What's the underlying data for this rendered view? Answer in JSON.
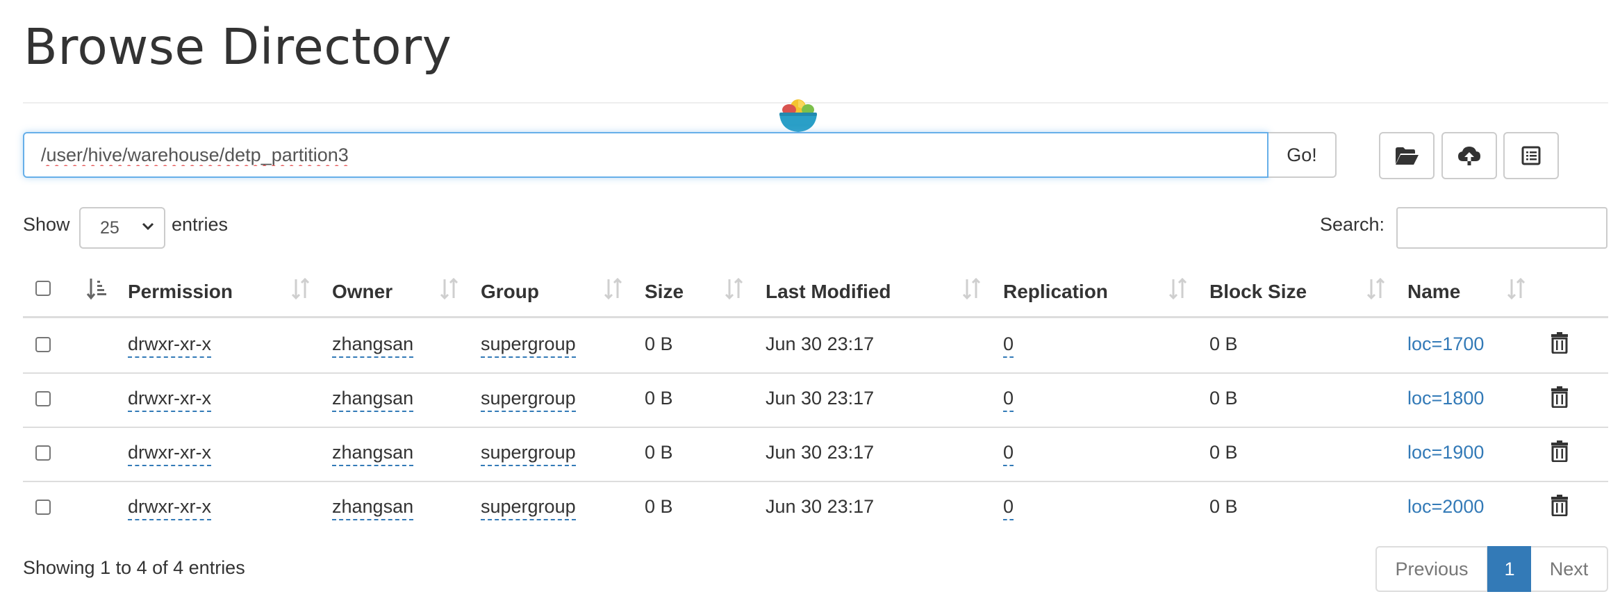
{
  "page": {
    "title": "Browse Directory"
  },
  "path_bar": {
    "value": "/user/hive/warehouse/detp_partition3",
    "go_label": "Go!"
  },
  "length": {
    "show_label": "Show",
    "selected": "25",
    "entries_label": "entries"
  },
  "search": {
    "label": "Search:",
    "value": ""
  },
  "table": {
    "columns": [
      "Permission",
      "Owner",
      "Group",
      "Size",
      "Last Modified",
      "Replication",
      "Block Size",
      "Name"
    ],
    "rows": [
      {
        "permission": "drwxr-xr-x",
        "owner": "zhangsan",
        "group": "supergroup",
        "size": "0 B",
        "modified": "Jun 30 23:17",
        "replication": "0",
        "block_size": "0 B",
        "name": "loc=1700"
      },
      {
        "permission": "drwxr-xr-x",
        "owner": "zhangsan",
        "group": "supergroup",
        "size": "0 B",
        "modified": "Jun 30 23:17",
        "replication": "0",
        "block_size": "0 B",
        "name": "loc=1800"
      },
      {
        "permission": "drwxr-xr-x",
        "owner": "zhangsan",
        "group": "supergroup",
        "size": "0 B",
        "modified": "Jun 30 23:17",
        "replication": "0",
        "block_size": "0 B",
        "name": "loc=1900"
      },
      {
        "permission": "drwxr-xr-x",
        "owner": "zhangsan",
        "group": "supergroup",
        "size": "0 B",
        "modified": "Jun 30 23:17",
        "replication": "0",
        "block_size": "0 B",
        "name": "loc=2000"
      }
    ]
  },
  "footer": {
    "info": "Showing 1 to 4 of 4 entries",
    "previous": "Previous",
    "current_page": "1",
    "next": "Next"
  },
  "icons": {
    "toolbar": [
      "folder-open-icon",
      "cloud-upload-icon",
      "list-alt-icon"
    ],
    "row_action": "trash-icon",
    "sort": "sort-icon"
  },
  "colors": {
    "link": "#337ab7",
    "active_page": "#337ab7",
    "focus": "#66afe9"
  }
}
